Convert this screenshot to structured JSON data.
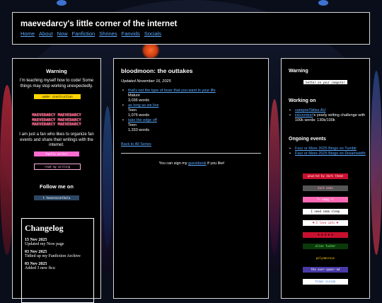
{
  "site": {
    "title": "maevedarcy's little corner of the internet",
    "nav": [
      "Home",
      "About",
      "Now",
      "Fanfiction",
      "Shrines",
      "Fanvids",
      "Socials"
    ]
  },
  "left": {
    "warning_heading": "Warning",
    "warning_text": "I'm teaching myself how to code! Some things may stop working unexpectedly.",
    "construction_badge": "under construction",
    "wordmark": "MAEVEDARCY",
    "fan_text": "I am just a fan who likes to organize fan events and share their writings with the internet.",
    "badge_a": "fanfic writer",
    "badge_b": "read my writing",
    "follow_heading": "Follow me on",
    "tumblr_badge": "t  heavenconthala",
    "changelog": {
      "title": "Changelog",
      "entries": [
        {
          "date": "15 Nov 2025",
          "text": "Updated my Now page"
        },
        {
          "date": "03 Nov 2025",
          "text": "Tidied up my Fanfiction Archive"
        },
        {
          "date": "03 Nov 2025",
          "text": "Added 3 new fics:"
        }
      ]
    }
  },
  "middle": {
    "title": "bloodmoon: the outtakes",
    "updated": "Updated November 16, 2025",
    "stories": [
      {
        "title": "that's not the type of lover that you want in your life",
        "rating": "Mature",
        "words": "3,036 words"
      },
      {
        "title": "as long as we live",
        "rating": "Teen",
        "words": "1,076 words"
      },
      {
        "title": "take the edge off",
        "rating": "Teen",
        "words": "1,333 words"
      }
    ],
    "back_link": "Back to All Series",
    "guestbook_pre": "You can sign my ",
    "guestbook_link": "guestbook",
    "guestbook_post": " if you like!"
  },
  "right": {
    "warning_heading": "Warning",
    "computer_badge": "better on your computer",
    "working_heading": "Working on",
    "working": [
      {
        "link": "vampire!Stiles AU",
        "text": ""
      },
      {
        "link": "inkvember",
        "text": "'s yearly writing challenge with 100k words: 130k/100k"
      }
    ],
    "events_heading": "Ongoing events",
    "events": [
      {
        "link": "Four or More 2025 Bingo on Tumblr"
      },
      {
        "link": "Four or More 2025 Bingo on Dreamwidth"
      }
    ],
    "badges": [
      {
        "text": "powered by dark theme",
        "bg": "#c8102e",
        "fg": "#ffdddd"
      },
      {
        "text": "dark mode",
        "bg": "#555555",
        "fg": "#ff9dc8"
      },
      {
        "text": "*~ swag ~*",
        "bg": "#ff69b4",
        "fg": "#ffffff"
      },
      {
        "text": "I need some sleep",
        "bg": "#ffffff",
        "fg": "#000000"
      },
      {
        "text": "♥ I love cats ♥",
        "bg": "#ffffff",
        "fg": "#c8102e"
      },
      {
        "text": "▼ ▼ ▼ ▼ ▼",
        "bg": "#c8102e",
        "fg": "#000000"
      },
      {
        "text": "alien fucker",
        "bg": "#0a3a0a",
        "fg": "#7cff7c"
      },
      {
        "text": "polyamorous",
        "bg": "#000000",
        "fg": "#ffd000"
      },
      {
        "text": "the ever-queer-ed",
        "bg": "#4a3aa8",
        "fg": "#ffffff"
      },
      {
        "text": "trans vision",
        "bg": "#ffffff",
        "fg": "#2a6ecf"
      }
    ]
  },
  "colors": {
    "accent_link": "#5aa9ff",
    "panel_bg": "#000000",
    "page_bg": "#0a0e1a"
  }
}
